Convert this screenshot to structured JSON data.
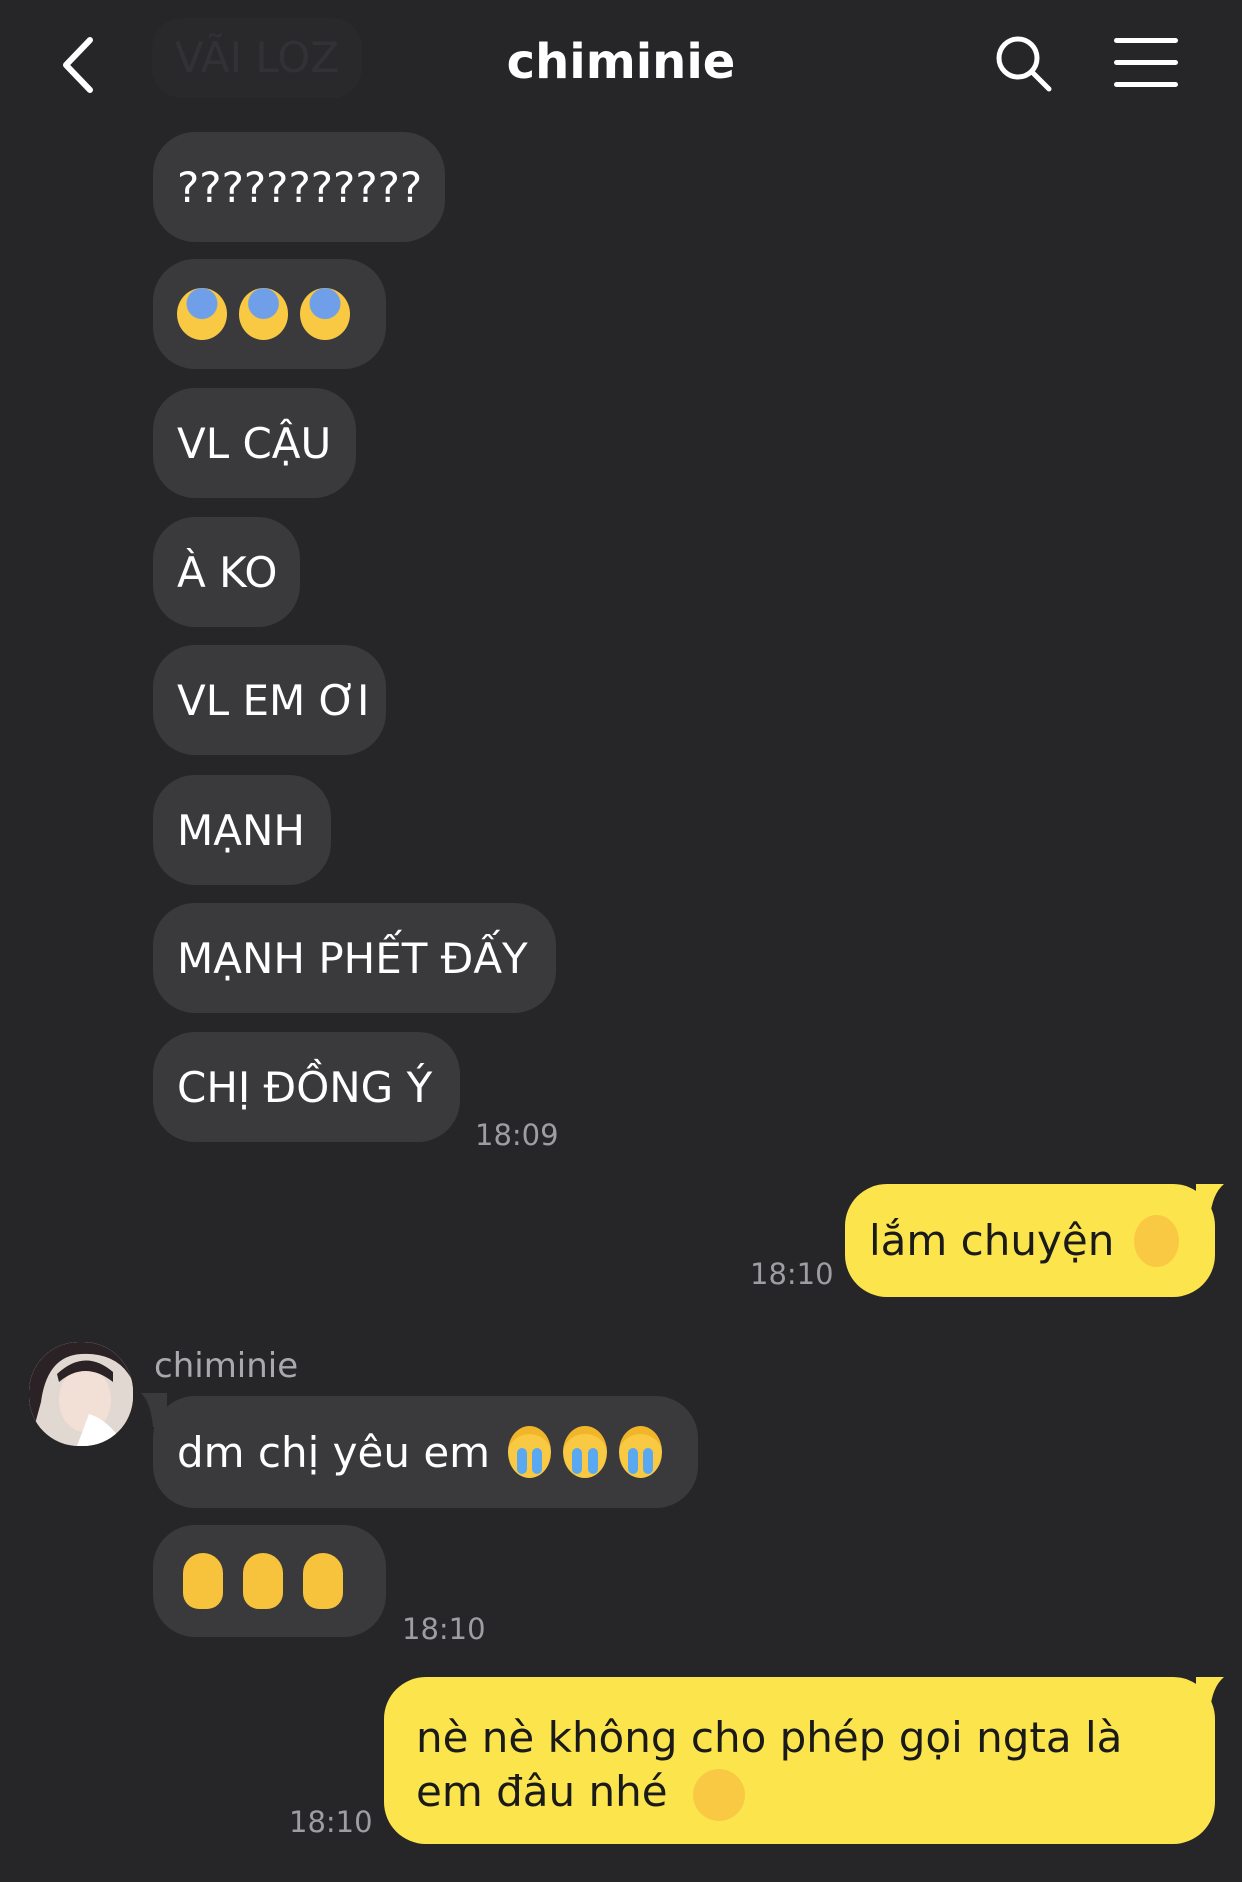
{
  "header": {
    "title": "chiminie",
    "faded_bubble": "VÃI LOZ"
  },
  "messages": {
    "m1": "???????????",
    "m2_icon": "anxious-face-with-sweat",
    "m3": "VL CẬU",
    "m4": "À KO",
    "m5": "VL EM ƠI",
    "m6": "MẠNH",
    "m7": "MẠNH PHẾT ĐẤY",
    "m8": "CHỊ ĐỒNG Ý",
    "t1": "18:09",
    "out1": "lắm chuyện",
    "out1_icon": "grinning-face-with-sweat",
    "t2": "18:10",
    "sender": "chiminie",
    "m9": "dm chị yêu em",
    "m9_icon": "loudly-crying-face",
    "m10_icon": "crossed-fingers",
    "t3": "18:10",
    "out2": "nè nè không cho phép gọi ngta là em đâu nhé",
    "out2_icon": "slightly-smiling-face",
    "t4": "18:10"
  },
  "colors": {
    "background": "#262629",
    "incoming_bubble": "#3a3a3d",
    "outgoing_bubble": "#fce54c",
    "timestamp": "#9d9da2"
  }
}
